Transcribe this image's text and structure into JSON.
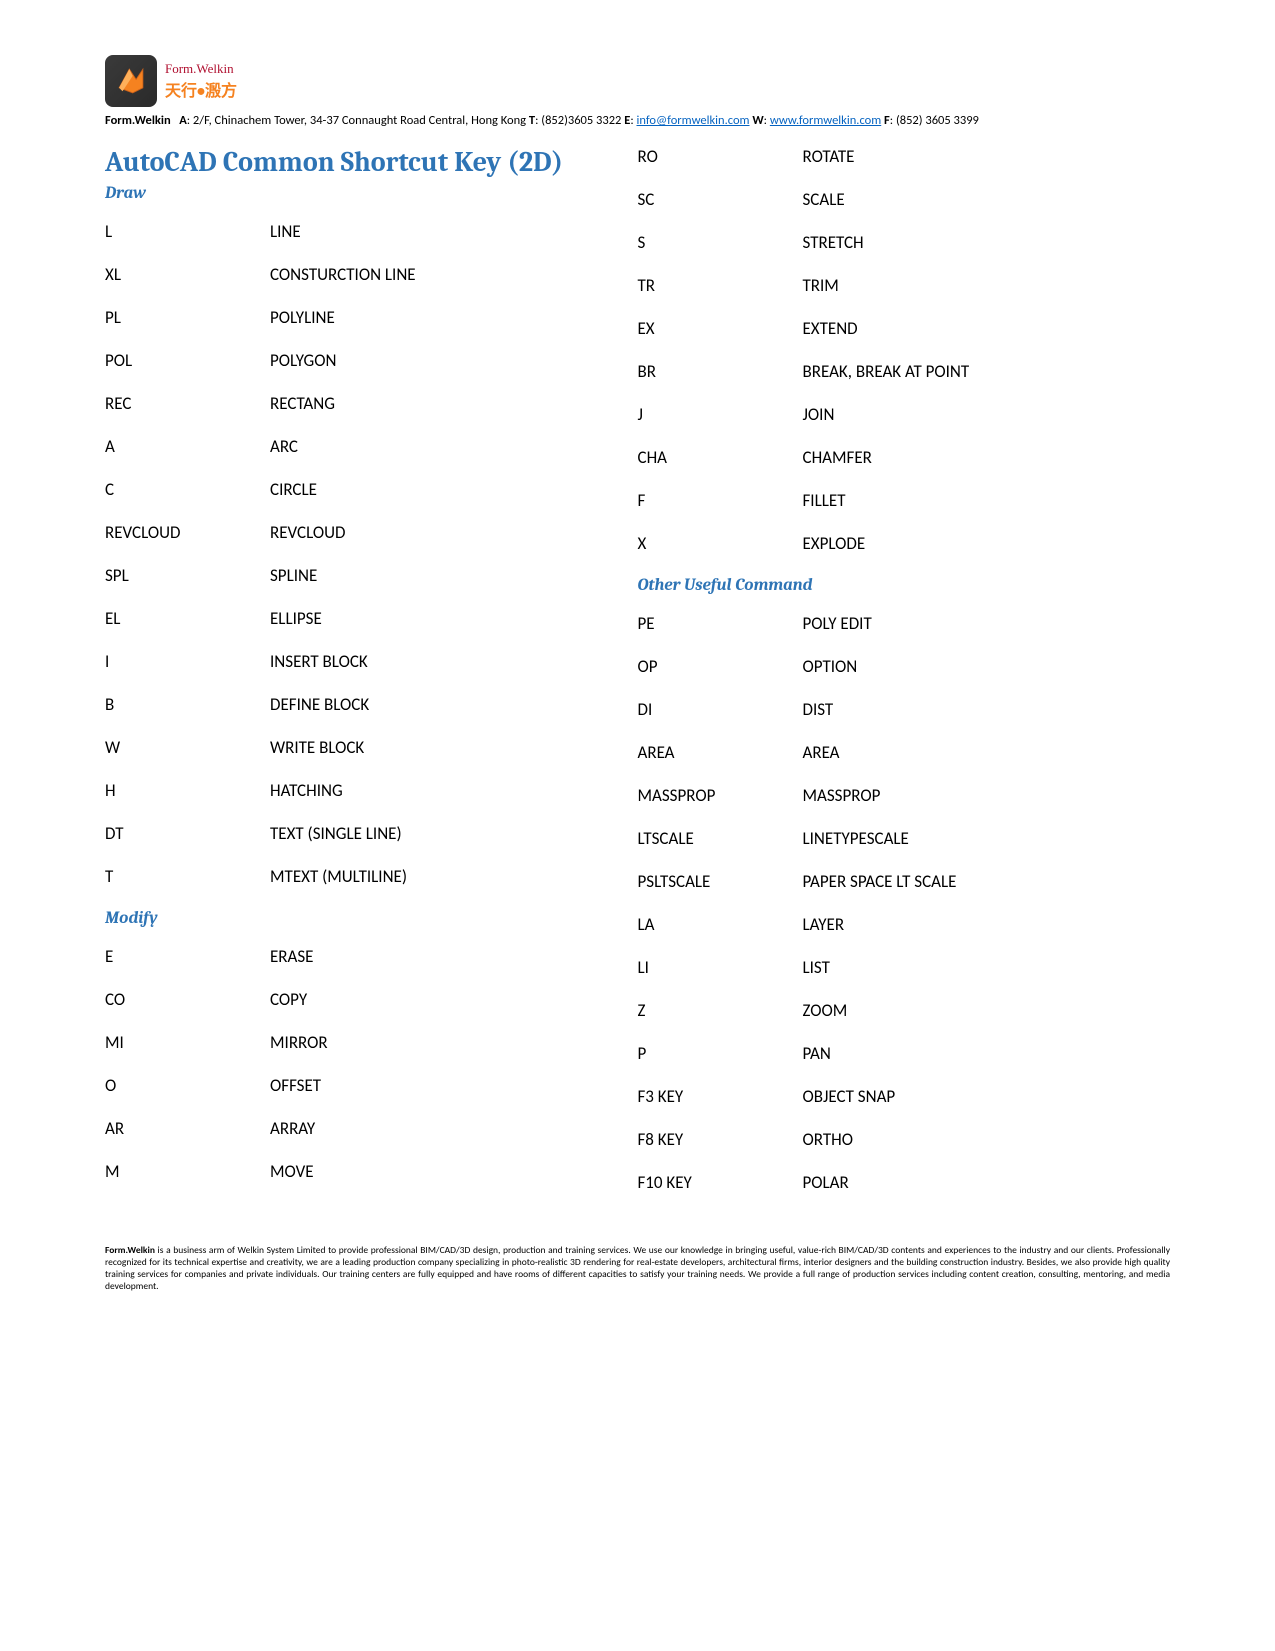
{
  "logo": {
    "brand": "Form.Welkin",
    "cjk": "天行•溵方"
  },
  "header": {
    "company": "Form.Welkin",
    "label_a": "A",
    "address": ": 2/F, Chinachem Tower, 34-37 Connaught Road Central, Hong Kong ",
    "label_t": "T",
    "tel": ": (852)3605 3322 ",
    "label_e": "E",
    "elead": ": ",
    "email": "info@formwelkin.com",
    "label_w": "W",
    "wlead": ": ",
    "web": "www.formwelkin.com",
    "label_f": "F",
    "fax": ": (852) 3605 3399"
  },
  "title": "AutoCAD Common Shortcut Key (2D)",
  "sections": {
    "draw": {
      "label": "Draw",
      "rows": [
        {
          "k": "L",
          "c": "LINE"
        },
        {
          "k": "XL",
          "c": "CONSTURCTION LINE"
        },
        {
          "k": "PL",
          "c": "POLYLINE"
        },
        {
          "k": "POL",
          "c": "POLYGON"
        },
        {
          "k": "REC",
          "c": "RECTANG"
        },
        {
          "k": "A",
          "c": "ARC"
        },
        {
          "k": "C",
          "c": "CIRCLE"
        },
        {
          "k": "REVCLOUD",
          "c": "REVCLOUD"
        },
        {
          "k": "SPL",
          "c": "SPLINE"
        },
        {
          "k": "EL",
          "c": "ELLIPSE"
        },
        {
          "k": "I",
          "c": "INSERT BLOCK"
        },
        {
          "k": "B",
          "c": "DEFINE BLOCK"
        },
        {
          "k": "W",
          "c": "WRITE BLOCK"
        },
        {
          "k": "H",
          "c": "HATCHING"
        },
        {
          "k": "DT",
          "c": "TEXT (SINGLE LINE)"
        },
        {
          "k": "T",
          "c": "MTEXT (MULTILINE)"
        }
      ]
    },
    "modify": {
      "label": "Modify",
      "rows": [
        {
          "k": "E",
          "c": "ERASE"
        },
        {
          "k": "CO",
          "c": "COPY"
        },
        {
          "k": "MI",
          "c": "MIRROR"
        },
        {
          "k": "O",
          "c": "OFFSET"
        },
        {
          "k": "AR",
          "c": "ARRAY"
        },
        {
          "k": "M",
          "c": "MOVE"
        }
      ]
    },
    "modify2": {
      "rows": [
        {
          "k": "RO",
          "c": "ROTATE"
        },
        {
          "k": "SC",
          "c": "SCALE"
        },
        {
          "k": "S",
          "c": "STRETCH"
        },
        {
          "k": "TR",
          "c": "TRIM"
        },
        {
          "k": "EX",
          "c": "EXTEND"
        },
        {
          "k": "BR",
          "c": "BREAK, BREAK AT POINT"
        },
        {
          "k": "J",
          "c": "JOIN"
        },
        {
          "k": "CHA",
          "c": "CHAMFER"
        },
        {
          "k": "F",
          "c": "FILLET"
        },
        {
          "k": "X",
          "c": "EXPLODE"
        }
      ]
    },
    "other": {
      "label": "Other Useful Command",
      "rows": [
        {
          "k": "PE",
          "c": "POLY EDIT"
        },
        {
          "k": "OP",
          "c": "OPTION"
        },
        {
          "k": "DI",
          "c": "DIST"
        },
        {
          "k": "AREA",
          "c": "AREA"
        },
        {
          "k": "MASSPROP",
          "c": "MASSPROP"
        },
        {
          "k": "LTSCALE",
          "c": "LINETYPESCALE"
        },
        {
          "k": "PSLTSCALE",
          "c": "PAPER SPACE LT SCALE"
        },
        {
          "k": "LA",
          "c": "LAYER"
        },
        {
          "k": "LI",
          "c": "LIST"
        },
        {
          "k": "Z",
          "c": "ZOOM"
        },
        {
          "k": "P",
          "c": "PAN"
        },
        {
          "k": "F3 KEY",
          "c": "OBJECT SNAP"
        },
        {
          "k": "F8 KEY",
          "c": "ORTHO"
        },
        {
          "k": "F10 KEY",
          "c": "POLAR"
        }
      ]
    }
  },
  "footer": {
    "company": "Form.Welkin",
    "text": " is a business arm of Welkin System Limited to provide professional BIM/CAD/3D design, production and training services. We use our knowledge in bringing useful, value-rich BIM/CAD/3D contents and experiences to the industry and our clients. Professionally recognized for its technical expertise and creativity, we are a leading production company specializing in photo-realistic 3D rendering for real-estate developers, architectural firms, interior designers and the building construction industry. Besides, we also provide high quality training services for companies and private individuals. Our training centers are fully equipped and have rooms of different capacities to satisfy your training needs. We provide a full range of production services including content creation, consulting, mentoring, and media development."
  }
}
